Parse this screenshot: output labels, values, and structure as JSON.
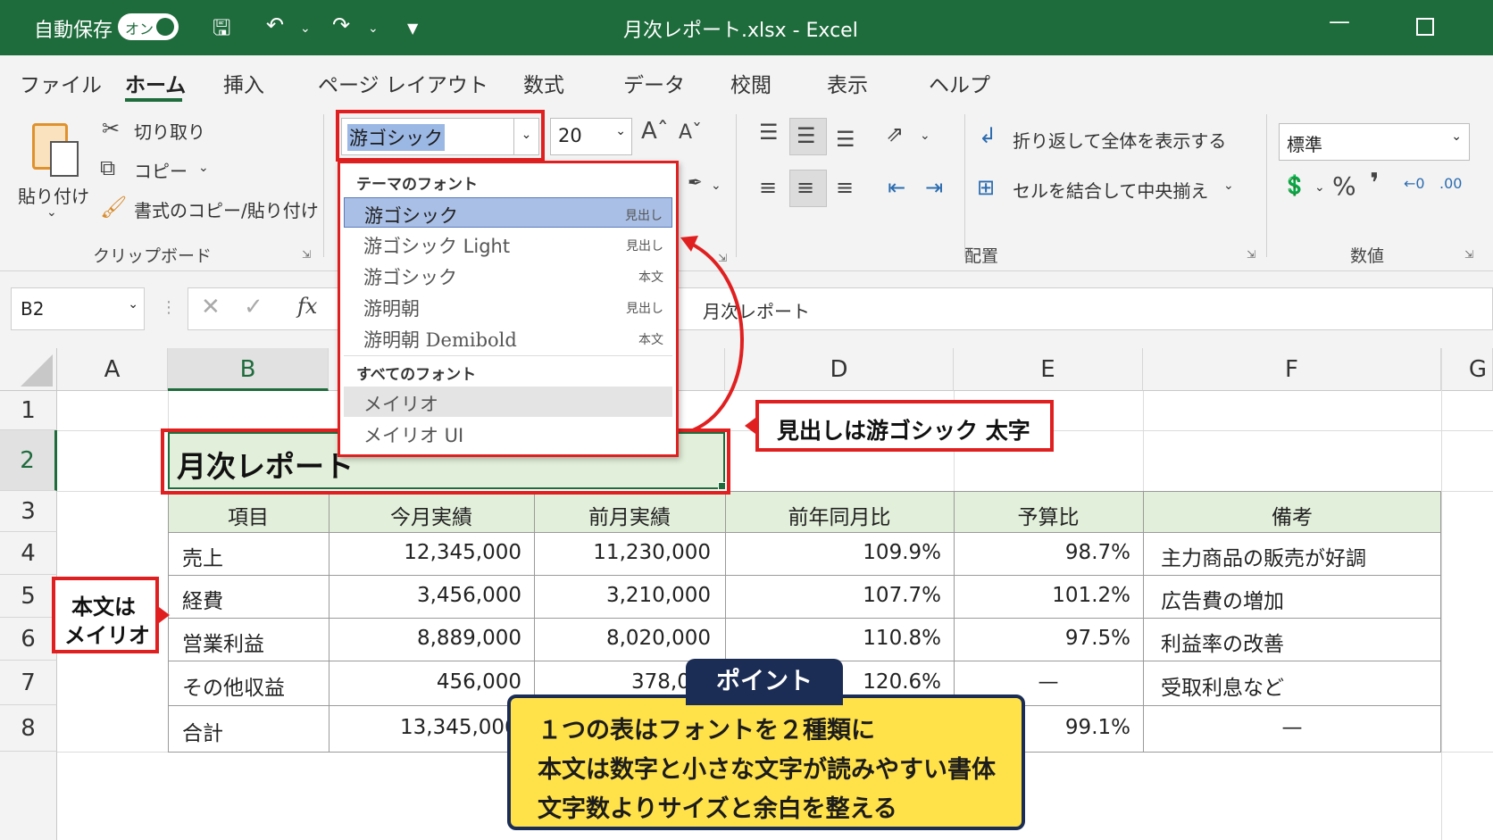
{
  "titlebar": {
    "autosave_label": "自動保存",
    "toggle_label": "オン",
    "title": "月次レポート.xlsx  -  Excel"
  },
  "tabs": [
    "ファイル",
    "ホーム",
    "挿入",
    "ページ レイアウト",
    "数式",
    "データ",
    "校閲",
    "表示",
    "ヘルプ"
  ],
  "ribbon": {
    "paste": "貼り付け",
    "cut": "切り取り",
    "copy": "コピー",
    "format_painter": "書式のコピー/貼り付け",
    "clipboard_group": "クリップボード",
    "font_name": "游ゴシック",
    "font_size": "20",
    "wrap_text": "折り返して全体を表示する",
    "merge_center": "セルを結合して中央揃え",
    "alignment_group": "配置",
    "number_format": "標準",
    "number_group": "数値"
  },
  "formula_bar": {
    "name_box": "B2",
    "fx": "fx",
    "content": "月次レポート"
  },
  "font_dropdown": {
    "theme_header": "テーマのフォント",
    "all_header": "すべてのフォント",
    "theme_fonts": [
      {
        "name": "游ゴシック",
        "tag": "見出し"
      },
      {
        "name": "游ゴシック Light",
        "tag": "見出し"
      },
      {
        "name": "游ゴシック",
        "tag": "本文"
      },
      {
        "name": "游明朝",
        "tag": "見出し"
      },
      {
        "name": "游明朝 Demibold",
        "tag": "本文"
      }
    ],
    "all_fonts": [
      "メイリオ",
      "メイリオ UI"
    ]
  },
  "sheet": {
    "columns": [
      "A",
      "B",
      "C",
      "D",
      "E",
      "F",
      "G"
    ],
    "rows": [
      "1",
      "2",
      "3",
      "4",
      "5",
      "6",
      "7",
      "8"
    ],
    "title": "月次レポート",
    "headers": [
      "項目",
      "今月実績",
      "前月実績",
      "前年同月比",
      "予算比",
      "備考"
    ],
    "data": [
      [
        "売上",
        "12,345,000",
        "11,230,000",
        "109.9%",
        "98.7%",
        "主力商品の販売が好調"
      ],
      [
        "経費",
        "3,456,000",
        "3,210,000",
        "107.7%",
        "101.2%",
        "広告費の増加"
      ],
      [
        "営業利益",
        "8,889,000",
        "8,020,000",
        "110.8%",
        "97.5%",
        "利益率の改善"
      ],
      [
        "その他収益",
        "456,000",
        "378,0",
        "120.6%",
        "—",
        "受取利息など"
      ],
      [
        "合計",
        "13,345,000",
        "",
        "",
        "99.1%",
        "—"
      ]
    ]
  },
  "callouts": {
    "heading_note": "見出しは游ゴシック 太字",
    "body_note_line1": "本文は",
    "body_note_line2": "メイリオ",
    "point_tab": "ポイント",
    "point_lines": [
      "１つの表はフォントを２種類に",
      "本文は数字と小さな文字が読みやすい書体",
      "文字数よりサイズと余白を整える"
    ]
  },
  "colors": {
    "excel_green": "#1e6b3c",
    "callout_red": "#e02020",
    "point_yellow": "#ffe14a",
    "point_navy": "#1c2d55",
    "header_fill": "#e2efda"
  }
}
